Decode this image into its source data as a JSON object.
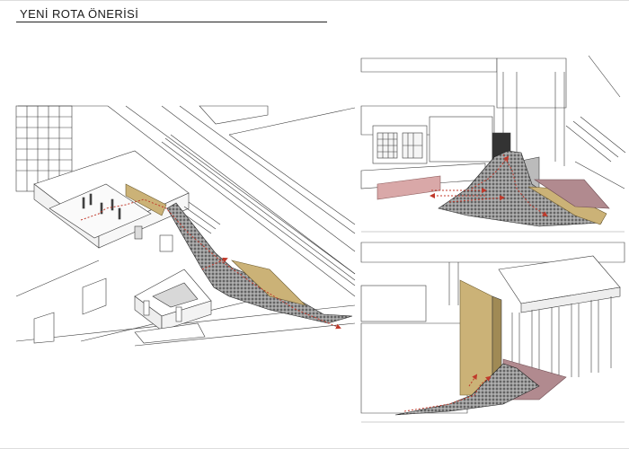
{
  "page": {
    "title": "YENİ ROTA ÖNERİSİ"
  },
  "colors": {
    "route": "#c0392b",
    "ochre": "#cbb277",
    "mauve": "#b18a8f",
    "pink": "#d9a8a8",
    "line": "#3a3a3a",
    "paving": "#8e8e8e"
  }
}
